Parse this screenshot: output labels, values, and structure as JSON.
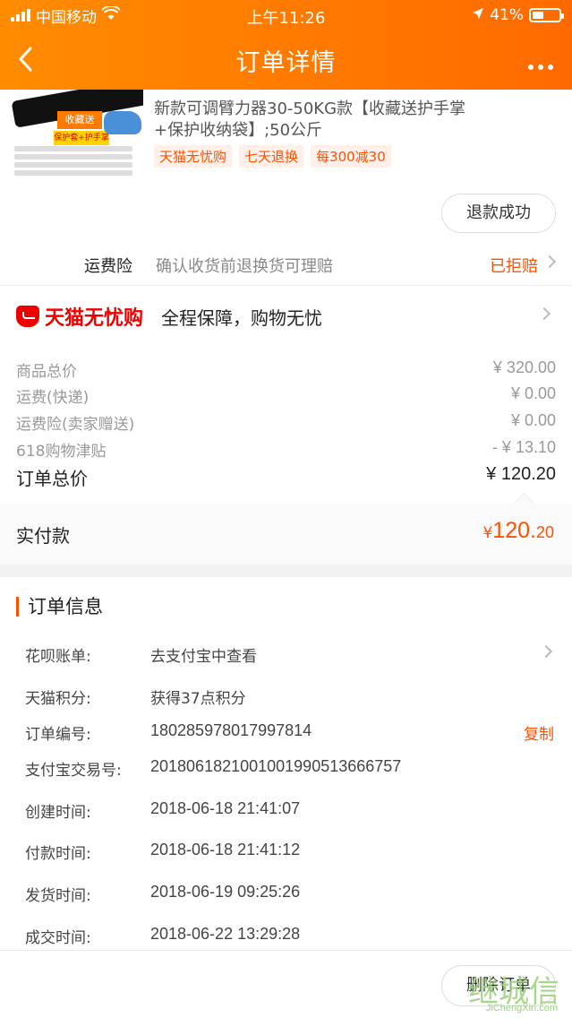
{
  "status": {
    "carrier": "中国移动",
    "time": "上午11:26",
    "battery": "41%"
  },
  "nav": {
    "title": "订单详情",
    "back_icon": "back-chevron-icon",
    "more_icon": "more-dots-icon"
  },
  "product": {
    "title_line1": "新款可调臂力器30-50KG款【收藏送护手掌",
    "title_line2": "+保护收纳袋】;50公斤",
    "tags": [
      "天猫无忧购",
      "七天退换",
      "每300减30"
    ],
    "image_badge": "收藏送",
    "image_badge2": "保护套+护手掌"
  },
  "refund_button": "退款成功",
  "freight_insurance": {
    "label": "运费险",
    "desc": "确认收货前退换货可理赔",
    "status": "已拒赔"
  },
  "worry_free": {
    "brand": "天猫无忧购",
    "slogan": "全程保障，购物无忧"
  },
  "prices": [
    {
      "label": "商品总价",
      "amount": "¥ 320.00"
    },
    {
      "label": "运费(快递)",
      "amount": "¥ 0.00"
    },
    {
      "label": "运费险(卖家赠送)",
      "amount": "¥ 0.00"
    },
    {
      "label": "618购物津贴",
      "amount": "- ¥ 13.10"
    }
  ],
  "order_total": {
    "label": "订单总价",
    "amount": "¥ 120.20"
  },
  "paid": {
    "label": "实付款",
    "currency": "¥",
    "int": "120.",
    "dec": "20"
  },
  "order_info": {
    "header": "订单信息",
    "rows": [
      {
        "label": "花呗账单:",
        "value": "去支付宝中查看"
      },
      {
        "label": "天猫积分:",
        "value": "获得37点积分"
      },
      {
        "label": "订单编号:",
        "value": "180285978017997814",
        "action": "复制"
      },
      {
        "label": "支付宝交易号:",
        "value": "2018061821001001990513666757"
      },
      {
        "label": "创建时间:",
        "value": "2018-06-18 21:41:07"
      },
      {
        "label": "付款时间:",
        "value": "2018-06-18 21:41:12"
      },
      {
        "label": "发货时间:",
        "value": "2018-06-19 09:25:26"
      },
      {
        "label": "成交时间:",
        "value": "2018-06-22 13:29:28"
      }
    ]
  },
  "bottom": {
    "delete_button": "删除订单"
  },
  "watermark": {
    "text": "继城信",
    "url": "JiChengXin.com"
  },
  "colors": {
    "accent": "#ff5000",
    "header": "#ff7a00",
    "tmall_red": "#e00000"
  }
}
